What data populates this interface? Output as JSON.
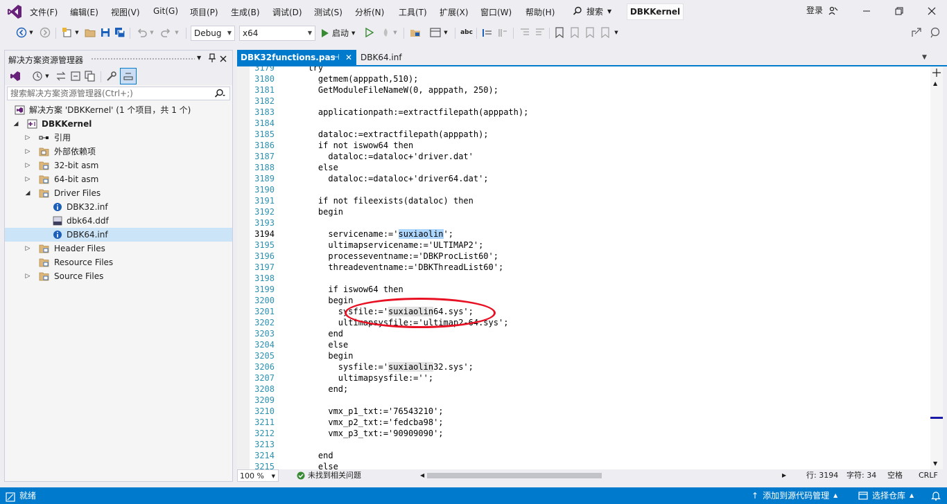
{
  "menu": {
    "items": [
      "文件(F)",
      "编辑(E)",
      "视图(V)",
      "Git(G)",
      "项目(P)",
      "生成(B)",
      "调试(D)",
      "测试(S)",
      "分析(N)",
      "工具(T)",
      "扩展(X)",
      "窗口(W)",
      "帮助(H)"
    ],
    "search_label": "搜索",
    "solution_name": "DBKKernel",
    "login": "登录"
  },
  "toolbar": {
    "config": "Debug",
    "platform": "x64",
    "start_label": "启动"
  },
  "solution_explorer": {
    "title": "解决方案资源管理器",
    "search_placeholder": "搜索解决方案资源管理器(Ctrl+;)",
    "tree": [
      {
        "label": "解决方案 'DBKKernel' (1 个项目，共 1 个)",
        "icon": "solution-icon"
      },
      {
        "label": "DBKKernel",
        "icon": "project-icon"
      },
      {
        "label": "引用",
        "icon": "references-icon"
      },
      {
        "label": "外部依赖项",
        "icon": "folder-icon"
      },
      {
        "label": "32-bit asm",
        "icon": "folder-icon"
      },
      {
        "label": "64-bit asm",
        "icon": "folder-icon"
      },
      {
        "label": "Driver Files",
        "icon": "folder-icon"
      },
      {
        "label": "DBK32.inf",
        "icon": "info-file-icon"
      },
      {
        "label": "dbk64.ddf",
        "icon": "ddf-file-icon"
      },
      {
        "label": "DBK64.inf",
        "icon": "info-file-icon"
      },
      {
        "label": "Header Files",
        "icon": "folder-icon"
      },
      {
        "label": "Resource Files",
        "icon": "folder-icon"
      },
      {
        "label": "Source Files",
        "icon": "folder-icon"
      }
    ]
  },
  "editor": {
    "tabs": [
      {
        "label": "DBK32functions.pas",
        "active": true
      },
      {
        "label": "DBK64.inf",
        "active": false
      }
    ],
    "lines": [
      {
        "n": "3179",
        "text": "  try"
      },
      {
        "n": "3180",
        "text": "    getmem(apppath,510);"
      },
      {
        "n": "3181",
        "text": "    GetModuleFileNameW(0, apppath, 250);"
      },
      {
        "n": "3182",
        "text": ""
      },
      {
        "n": "3183",
        "text": "    applicationpath:=extractfilepath(apppath);"
      },
      {
        "n": "3184",
        "text": ""
      },
      {
        "n": "3185",
        "text": "    dataloc:=extractfilepath(apppath);"
      },
      {
        "n": "3186",
        "text": "    if not iswow64 then"
      },
      {
        "n": "3187",
        "text": "      dataloc:=dataloc+'driver.dat'"
      },
      {
        "n": "3188",
        "text": "    else"
      },
      {
        "n": "3189",
        "text": "      dataloc:=dataloc+'driver64.dat';"
      },
      {
        "n": "3190",
        "text": ""
      },
      {
        "n": "3191",
        "text": "    if not fileexists(dataloc) then"
      },
      {
        "n": "3192",
        "text": "    begin"
      },
      {
        "n": "3193",
        "text": ""
      },
      {
        "n": "3194",
        "text": "      servicename:='suxiaolin';"
      },
      {
        "n": "3195",
        "text": "      ultimapservicename:='ULTIMAP2';"
      },
      {
        "n": "3196",
        "text": "      processeventname:='DBKProcList60';"
      },
      {
        "n": "3197",
        "text": "      threadeventname:='DBKThreadList60';"
      },
      {
        "n": "3198",
        "text": ""
      },
      {
        "n": "3199",
        "text": "      if iswow64 then"
      },
      {
        "n": "3200",
        "text": "      begin"
      },
      {
        "n": "3201",
        "text": "        sysfile:='suxiaolin64.sys';"
      },
      {
        "n": "3202",
        "text": "        ultimapsysfile:='ultimap2-64.sys';"
      },
      {
        "n": "3203",
        "text": "      end"
      },
      {
        "n": "3204",
        "text": "      else"
      },
      {
        "n": "3205",
        "text": "      begin"
      },
      {
        "n": "3206",
        "text": "        sysfile:='suxiaolin32.sys';"
      },
      {
        "n": "3207",
        "text": "        ultimapsysfile:='';"
      },
      {
        "n": "3208",
        "text": "      end;"
      },
      {
        "n": "3209",
        "text": ""
      },
      {
        "n": "3210",
        "text": "      vmx_p1_txt:='76543210';"
      },
      {
        "n": "3211",
        "text": "      vmx_p2_txt:='fedcba98';"
      },
      {
        "n": "3212",
        "text": "      vmx_p3_txt:='90909090';"
      },
      {
        "n": "3213",
        "text": ""
      },
      {
        "n": "3214",
        "text": "    end"
      },
      {
        "n": "3215",
        "text": "    else"
      }
    ],
    "current_line": "3194"
  },
  "editor_status": {
    "zoom": "100 %",
    "issues": "未找到相关问题",
    "line": "行: 3194",
    "char": "字符: 34",
    "whitespace": "空格",
    "eol": "CRLF"
  },
  "statusbar": {
    "ready": "就绪",
    "source_control": "添加到源代码管理",
    "repo": "选择仓库"
  },
  "colors": {
    "accent": "#007acc",
    "annotation": "#e81123",
    "line_number": "#2b91af",
    "highlight": "#add6ff"
  }
}
